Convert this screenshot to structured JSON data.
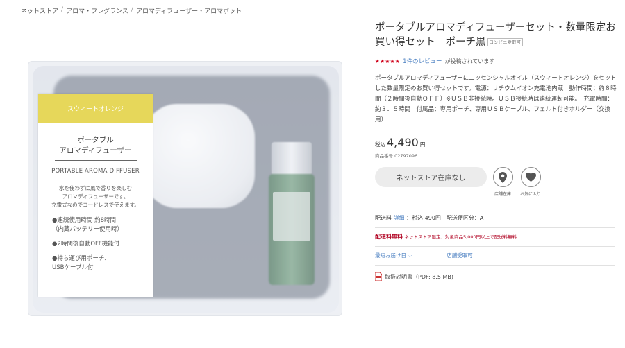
{
  "breadcrumb": [
    "ネットストア",
    "アロマ・フレグランス",
    "アロマディフューザー・アロマポット"
  ],
  "image_card": {
    "band_text": "スウィートオレンジ",
    "title_line1": "ポータブル",
    "title_line2": "アロマディフューザー",
    "title_en": "PORTABLE AROMA DIFFUSER",
    "desc_line1": "水を使わずに風で香りを楽しむ",
    "desc_line2": "アロマディフューザーです。",
    "desc_line3": "充電式なのでコードレスで使えます。",
    "point1_line1": "●連続使用時間 約8時間",
    "point1_line2": "（内蔵バッテリー使用時）",
    "point2": "●2時間後自動OFF機能付",
    "point3_line1": "●持ち運び用ポーチ、",
    "point3_line2": "USBケーブル付"
  },
  "product": {
    "title": "ポータブルアロマディフューザーセット・数量限定お買い得セット　ポーチ黒",
    "badge": "コンビニ受取可",
    "stars": "★★★★★",
    "review_link": "1件のレビュー",
    "review_suffix": "が投稿されています",
    "description": "ポータブルアロマディフューザーにエッセンシャルオイル（スウィートオレンジ）をセットした数量限定のお買い得セットです。電源：リチウムイオン充電池内蔵　動作時間：約８時間（２時間後自動ＯＦＦ）※ＵＳＢ非接続時。ＵＳＢ接続時は連続運転可能。　充電時間：約３．５時間　付属品：専用ポーチ、専用ＵＳＢケーブル、フェルト付きホルダー（交換用）",
    "tax_label": "税込",
    "price": "4,490",
    "yen": "円",
    "item_number": "商品番号 02797096"
  },
  "actions": {
    "stock_button": "ネットストア在庫なし",
    "store_stock_label": "店舗在庫",
    "favorite_label": "お気に入り",
    "store_icon": "map-pin-icon",
    "favorite_icon": "heart-icon"
  },
  "shipping": {
    "fee_label": "配送料",
    "detail_link": "詳細",
    "fee_text": "：税込 490円　配送便区分：A",
    "free_label": "配送料無料",
    "free_note": "ネットストア限定、対象商品5,000円以上で配送料無料",
    "earliest_link": "最短お届け日",
    "store_pickup_link": "店舗受取可"
  },
  "manual": {
    "icon": "pdf-icon",
    "text": "取扱説明書（PDF: 8.5 MB)"
  },
  "colors": {
    "accent_link": "#4a7fc1",
    "star_red": "#d0021b",
    "free_red": "#b00020",
    "band_yellow": "#e6d75a"
  }
}
